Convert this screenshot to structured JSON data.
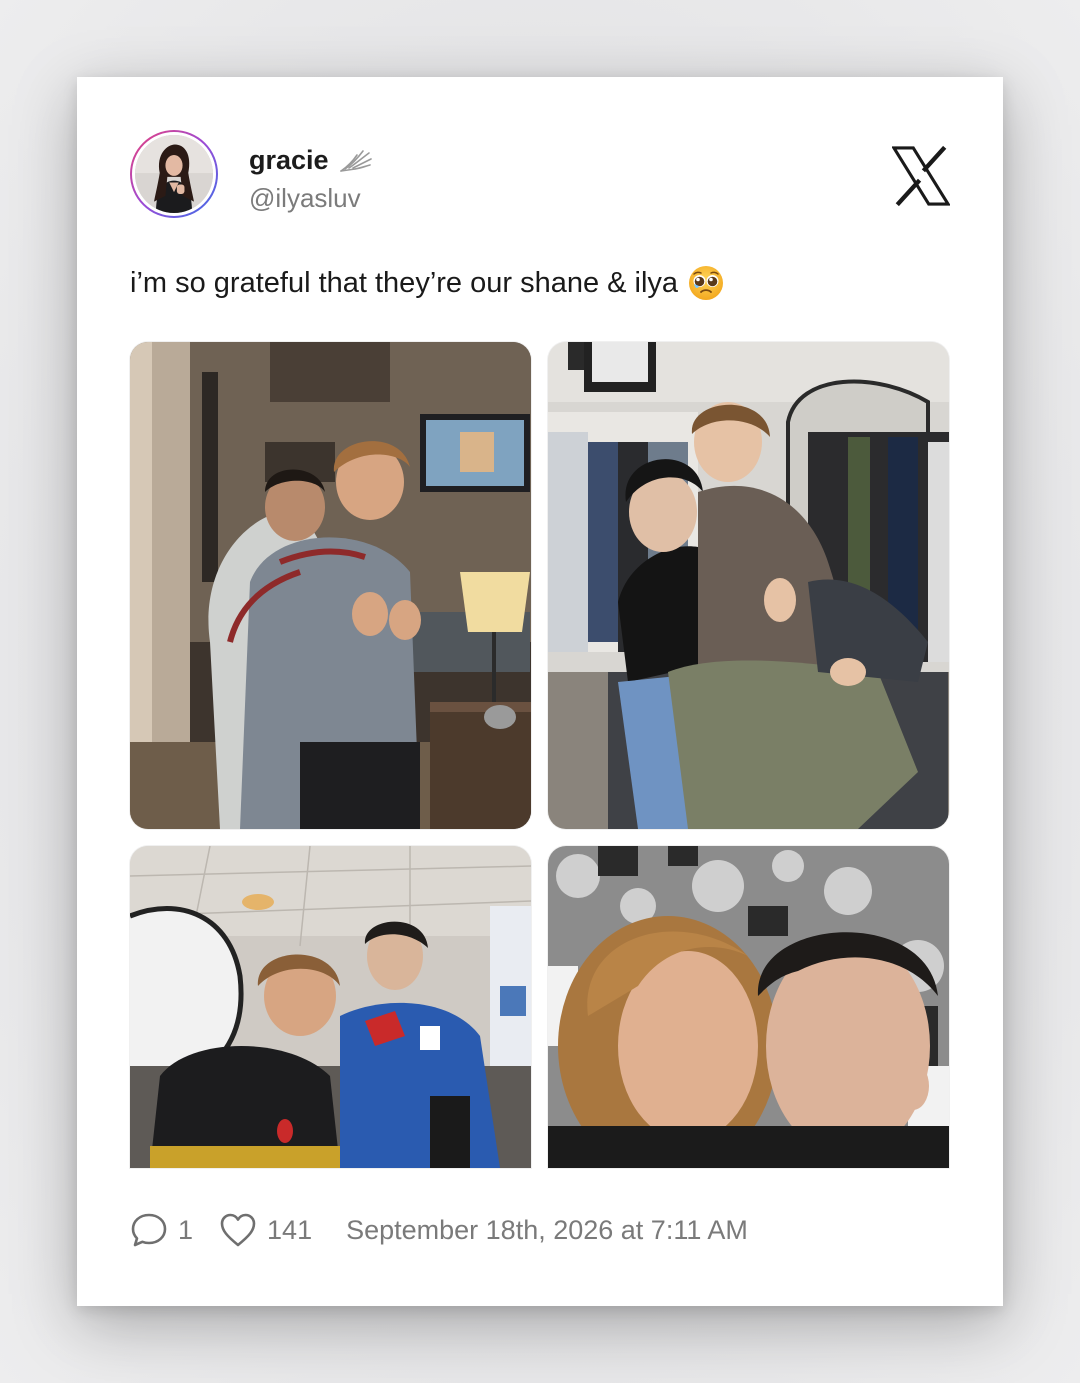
{
  "post": {
    "display_name": "gracie",
    "handle": "@ilyasluv",
    "badge_icon": "winged-badge-icon",
    "platform_icon": "x-logo-icon",
    "text": "i’m so grateful that they’re our shane & ilya",
    "text_emoji": "pleading-face-emoji"
  },
  "images": [
    {
      "name": "photo-living-room-hug"
    },
    {
      "name": "photo-wardrobe-embrace"
    },
    {
      "name": "photo-hockey-jerseys"
    },
    {
      "name": "photo-cheek-to-cheek-selfie"
    }
  ],
  "footer": {
    "reply_icon": "comment-icon",
    "reply_count": "1",
    "like_icon": "heart-icon",
    "like_count": "141",
    "timestamp": "September 18th, 2026 at 7:11 AM"
  },
  "colors": {
    "text": "#1a1a1a",
    "muted": "#7a7a7a",
    "card": "#ffffff"
  }
}
